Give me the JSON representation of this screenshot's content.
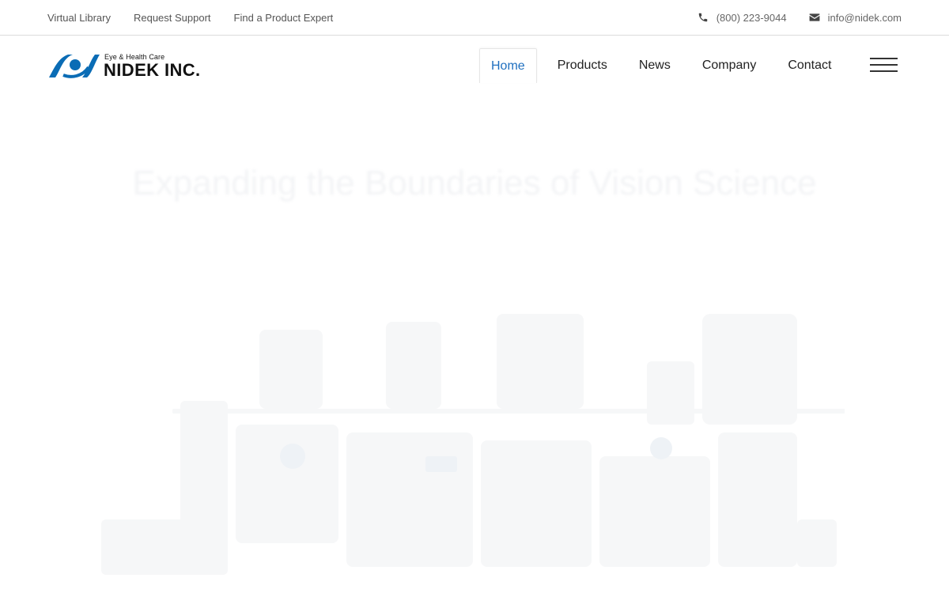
{
  "topbar": {
    "links": [
      "Virtual Library",
      "Request Support",
      "Find a Product Expert"
    ],
    "phone": "(800) 223-9044",
    "email": "info@nidek.com"
  },
  "header": {
    "logo": {
      "tagline": "Eye & Health Care",
      "brand": "NIDEK INC."
    },
    "nav": [
      "Home",
      "Products",
      "News",
      "Company",
      "Contact"
    ],
    "active_nav": "Home"
  },
  "hero": {
    "title": "Expanding the Boundaries of Vision Science"
  },
  "colors": {
    "accent": "#1f6fbf",
    "logo_blue": "#0a6cb5",
    "text": "#222222",
    "divider": "#dcdcdc"
  },
  "icons": [
    "phone-icon",
    "envelope-icon",
    "hamburger-menu-icon"
  ]
}
